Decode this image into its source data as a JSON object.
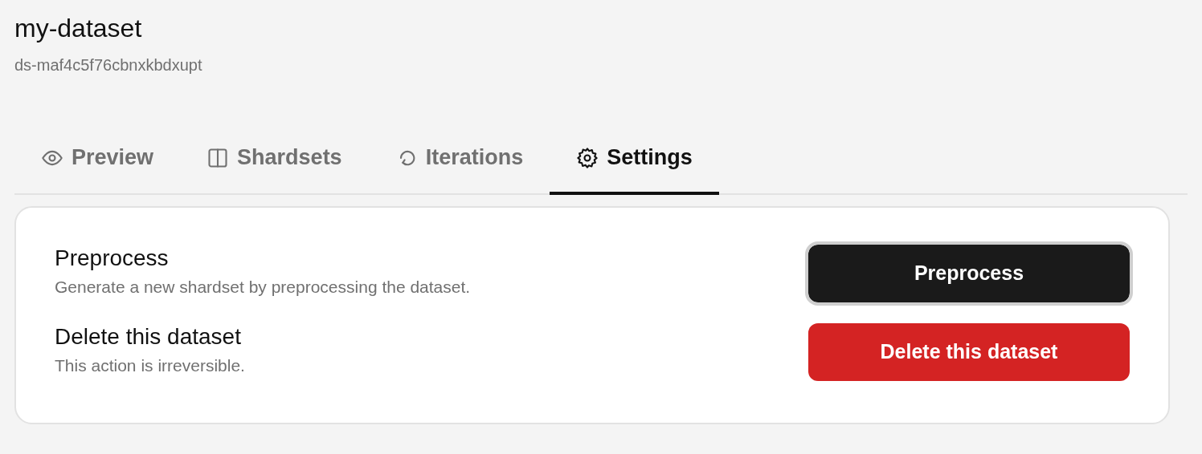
{
  "title": "my-dataset",
  "subtitle": "ds-maf4c5f76cbnxkbdxupt",
  "tabs": [
    {
      "label": "Preview",
      "kind": "eye",
      "selected": false
    },
    {
      "label": "Shardsets",
      "kind": "columns",
      "selected": false
    },
    {
      "label": "Iterations",
      "kind": "loop",
      "selected": false
    },
    {
      "label": "Settings",
      "kind": "gear",
      "selected": true
    }
  ],
  "settings": [
    {
      "title": "Preprocess",
      "description": "Generate a new shardset by preprocessing the dataset.",
      "button": "Preprocess",
      "kind": "primary",
      "focused": true
    },
    {
      "title": "Delete this dataset",
      "description": "This action is irreversible.",
      "button": "Delete this dataset",
      "kind": "danger",
      "focused": false
    }
  ]
}
